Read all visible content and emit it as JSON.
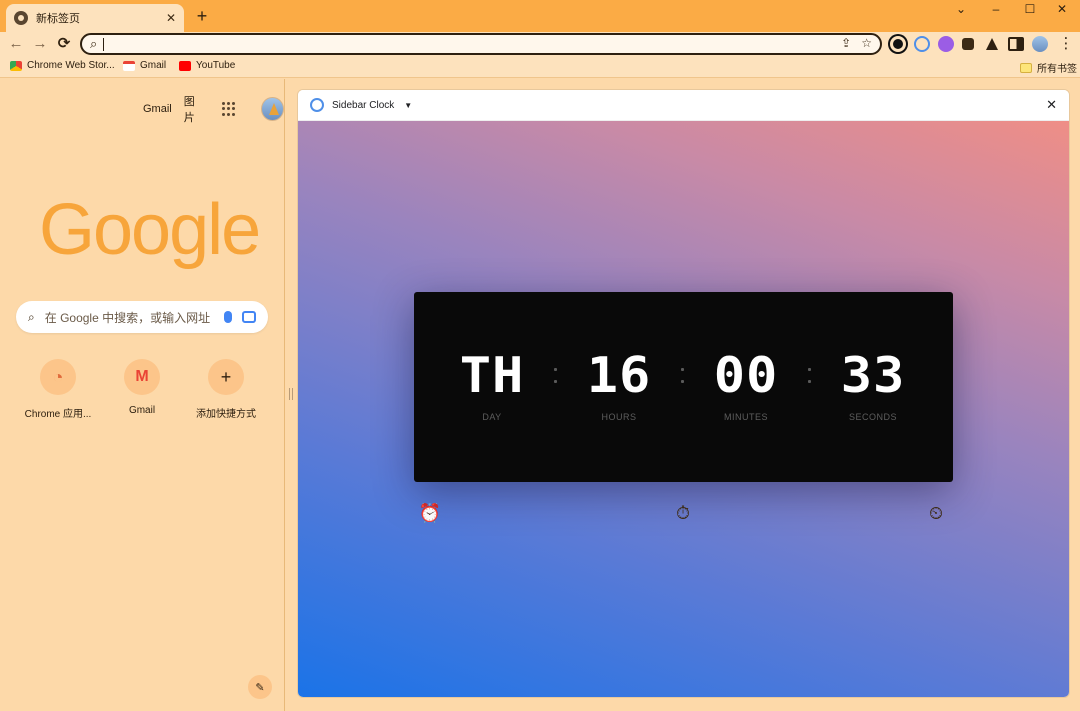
{
  "tab": {
    "title": "新标签页",
    "close": "✕",
    "new_tab": "+"
  },
  "window_controls": {
    "dropdown": "⌄",
    "minimize": "–",
    "maximize": "☐",
    "close": "✕"
  },
  "toolbar": {
    "back": "←",
    "forward": "→",
    "reload": "⟳",
    "search_icon": "⌕",
    "share": "⇪",
    "star": "☆",
    "menu": "⋮"
  },
  "bookmarks": {
    "items": [
      {
        "label": "Chrome Web Stor..."
      },
      {
        "label": "Gmail"
      },
      {
        "label": "YouTube"
      }
    ],
    "all": "所有书签"
  },
  "ntp": {
    "links": {
      "gmail": "Gmail",
      "images": "图片"
    },
    "logo": "Google",
    "search_placeholder": "在 Google 中搜索，或输入网址",
    "search_icon": "⌕",
    "shortcuts": [
      {
        "label": "Chrome 应用...",
        "icon": "◔"
      },
      {
        "label": "Gmail",
        "icon": "M"
      },
      {
        "label": "添加快捷方式",
        "icon": "+"
      }
    ],
    "edit": "✎"
  },
  "side_panel": {
    "title": "Sidebar Clock",
    "caret": "▼",
    "close": "✕",
    "clock": {
      "day": "TH",
      "hours": "16",
      "minutes": "00",
      "seconds": "33",
      "labels": {
        "day": "DAY",
        "hours": "HOURS",
        "minutes": "MINUTES",
        "seconds": "SECONDS"
      }
    },
    "tools": {
      "alarm": "⏰",
      "stopwatch": "⏱",
      "timer": "⏲"
    }
  },
  "colors": {
    "accent": "#fbab45",
    "page_bg": "#fdd9a9",
    "logo": "#f7a53b"
  }
}
